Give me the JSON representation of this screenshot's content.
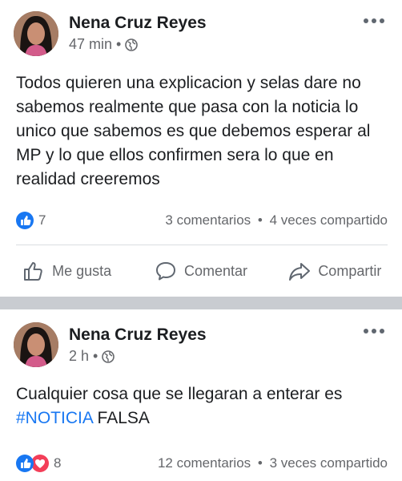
{
  "posts": [
    {
      "author": "Nena Cruz Reyes",
      "time": "47 min",
      "text": "Todos quieren una explicacion y selas dare no sabemos realmente que pasa con la noticia lo unico que sabemos es que debemos esperar al MP y lo que ellos confirmen sera lo que en realidad creeremos",
      "reaction_count": "7",
      "comments": "3 comentarios",
      "shares": "4 veces compartido",
      "actions": {
        "like": "Me gusta",
        "comment": "Comentar",
        "share": "Compartir"
      }
    },
    {
      "author": "Nena Cruz Reyes",
      "time": "2 h",
      "text_plain": "Cualquier cosa que se llegaran a enterar es ",
      "hashtag": "#NOTICIA",
      "text_tail": " FALSA",
      "reaction_count": "8",
      "comments": "12 comentarios",
      "shares": "3 veces compartido"
    }
  ],
  "separator": "•",
  "colors": {
    "like_blue": "#1877f2",
    "love_red": "#f33e58",
    "muted": "#65676b",
    "band": "#c9ccd1"
  },
  "icons": [
    "globe-icon",
    "more-icon",
    "like-reaction-icon",
    "love-reaction-icon",
    "thumbs-up-icon",
    "comment-icon",
    "share-icon"
  ]
}
